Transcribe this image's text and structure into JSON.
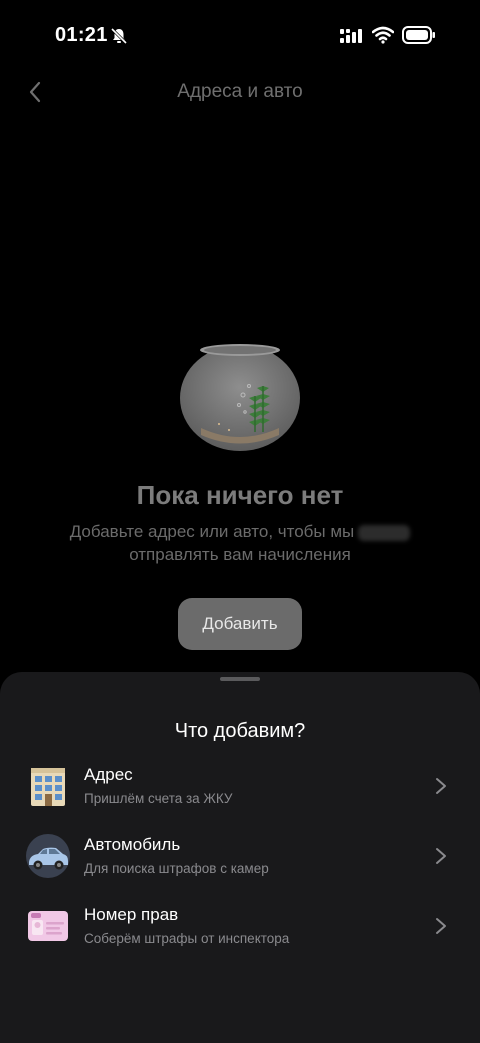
{
  "status_bar": {
    "time": "01:21"
  },
  "header": {
    "title": "Адреса и авто"
  },
  "empty_state": {
    "title": "Пока ничего нет",
    "description_line1": "Добавьте адрес или авто, чтобы мы",
    "description_line2": "отправлять вам начисления",
    "add_button_label": "Добавить"
  },
  "sheet": {
    "title": "Что добавим?",
    "options": [
      {
        "title": "Адрес",
        "subtitle": "Пришлём счета за ЖКУ",
        "icon": "building-icon"
      },
      {
        "title": "Автомобиль",
        "subtitle": "Для поиска штрафов с камер",
        "icon": "car-icon"
      },
      {
        "title": "Номер прав",
        "subtitle": "Соберём штрафы от инспектора",
        "icon": "license-icon"
      }
    ]
  },
  "colors": {
    "background": "#000000",
    "sheet": "#19191b",
    "muted_text": "#6b6b6b"
  }
}
